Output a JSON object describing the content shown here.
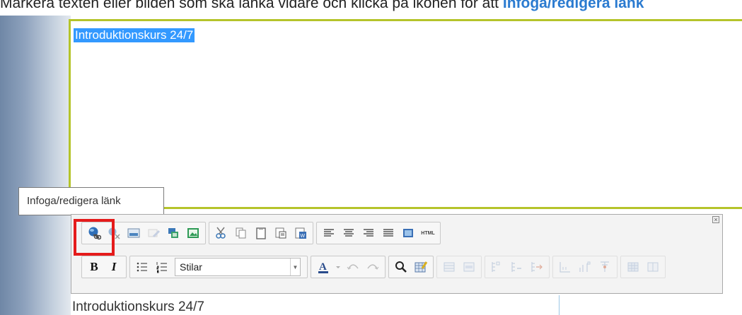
{
  "instruction": {
    "text": "Markera texten eller bilden som ska länka vidare och klicka på ikonen för att ",
    "highlight": "Infoga/redigera länk"
  },
  "editor": {
    "selected_text": "Introduktionskurs 24/7",
    "border_color": "#b5c42a",
    "selection_color": "#3399ff"
  },
  "tooltip": {
    "text": "Infoga/redigera länk"
  },
  "toolbar": {
    "close_label": "×",
    "styles_select": {
      "value": "Stilar"
    },
    "html_label": "HTML",
    "bold_label": "B",
    "italic_label": "I",
    "row1_icons": [
      "link-icon",
      "unlink-icon",
      "image-icon",
      "edit-icon",
      "insert-media-icon",
      "insert-picture-icon",
      "cut-icon",
      "copy-icon",
      "paste-icon",
      "paste-text-icon",
      "paste-word-icon",
      "align-left-icon",
      "align-center-icon",
      "align-right-icon",
      "justify-icon",
      "fullscreen-icon",
      "html-icon"
    ],
    "row2_icons": [
      "bold-icon",
      "italic-icon",
      "bullet-list-icon",
      "numbered-list-icon",
      "styles-dropdown",
      "font-color-icon",
      "undo-icon",
      "redo-icon",
      "search-icon",
      "insert-table-icon",
      "table-props-icon",
      "row-props-icon",
      "insert-row-icon",
      "delete-row-icon",
      "merge-cells-icon",
      "split-cells-icon",
      "table-split-icon",
      "table-grid-icon",
      "table-layout-icon"
    ],
    "highlight_color": "#e51b1b"
  },
  "page": {
    "bottom_text": "Introduktionskurs 24/7"
  }
}
